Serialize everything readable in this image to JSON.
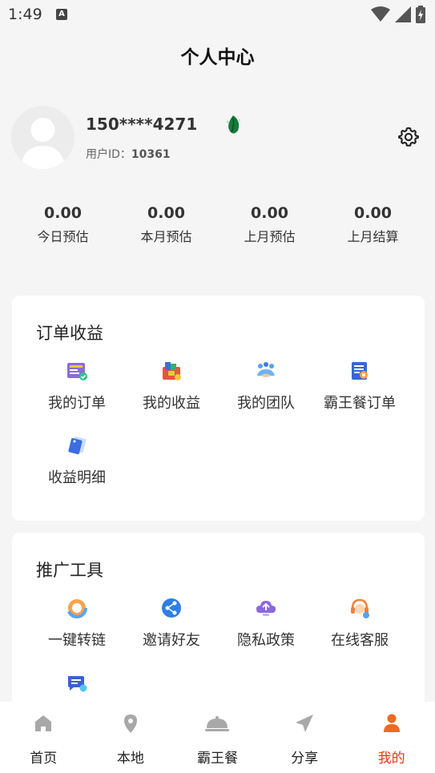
{
  "status_bar": {
    "time": "1:49",
    "indicator": "A"
  },
  "header": {
    "title": "个人中心"
  },
  "profile": {
    "phone": "150****4271",
    "user_id_label": "用户ID：",
    "user_id": "10361"
  },
  "stats": [
    {
      "value": "0.00",
      "label": "今日预估"
    },
    {
      "value": "0.00",
      "label": "本月预估"
    },
    {
      "value": "0.00",
      "label": "上月预估"
    },
    {
      "value": "0.00",
      "label": "上月结算"
    }
  ],
  "orders_section": {
    "title": "订单收益",
    "items": [
      {
        "label": "我的订单",
        "icon": "orders-icon"
      },
      {
        "label": "我的收益",
        "icon": "earnings-icon"
      },
      {
        "label": "我的团队",
        "icon": "team-icon"
      },
      {
        "label": "霸王餐订单",
        "icon": "free-meal-order-icon"
      },
      {
        "label": "收益明细",
        "icon": "earnings-detail-icon"
      }
    ]
  },
  "tools_section": {
    "title": "推广工具",
    "items": [
      {
        "label": "一键转链",
        "icon": "link-convert-icon"
      },
      {
        "label": "邀请好友",
        "icon": "invite-icon"
      },
      {
        "label": "隐私政策",
        "icon": "privacy-icon"
      },
      {
        "label": "在线客服",
        "icon": "customer-service-icon"
      },
      {
        "label": "",
        "icon": "feedback-icon"
      }
    ]
  },
  "tabbar": {
    "active": "我的",
    "items": [
      {
        "label": "首页",
        "icon": "home-icon"
      },
      {
        "label": "本地",
        "icon": "location-icon"
      },
      {
        "label": "霸王餐",
        "icon": "dish-cover-icon"
      },
      {
        "label": "分享",
        "icon": "send-icon"
      },
      {
        "label": "我的",
        "icon": "person-icon"
      }
    ]
  },
  "colors": {
    "accent": "#e6381a",
    "active_tab_icon": "#f06a1f",
    "inactive_icon": "#a8a8a8"
  }
}
